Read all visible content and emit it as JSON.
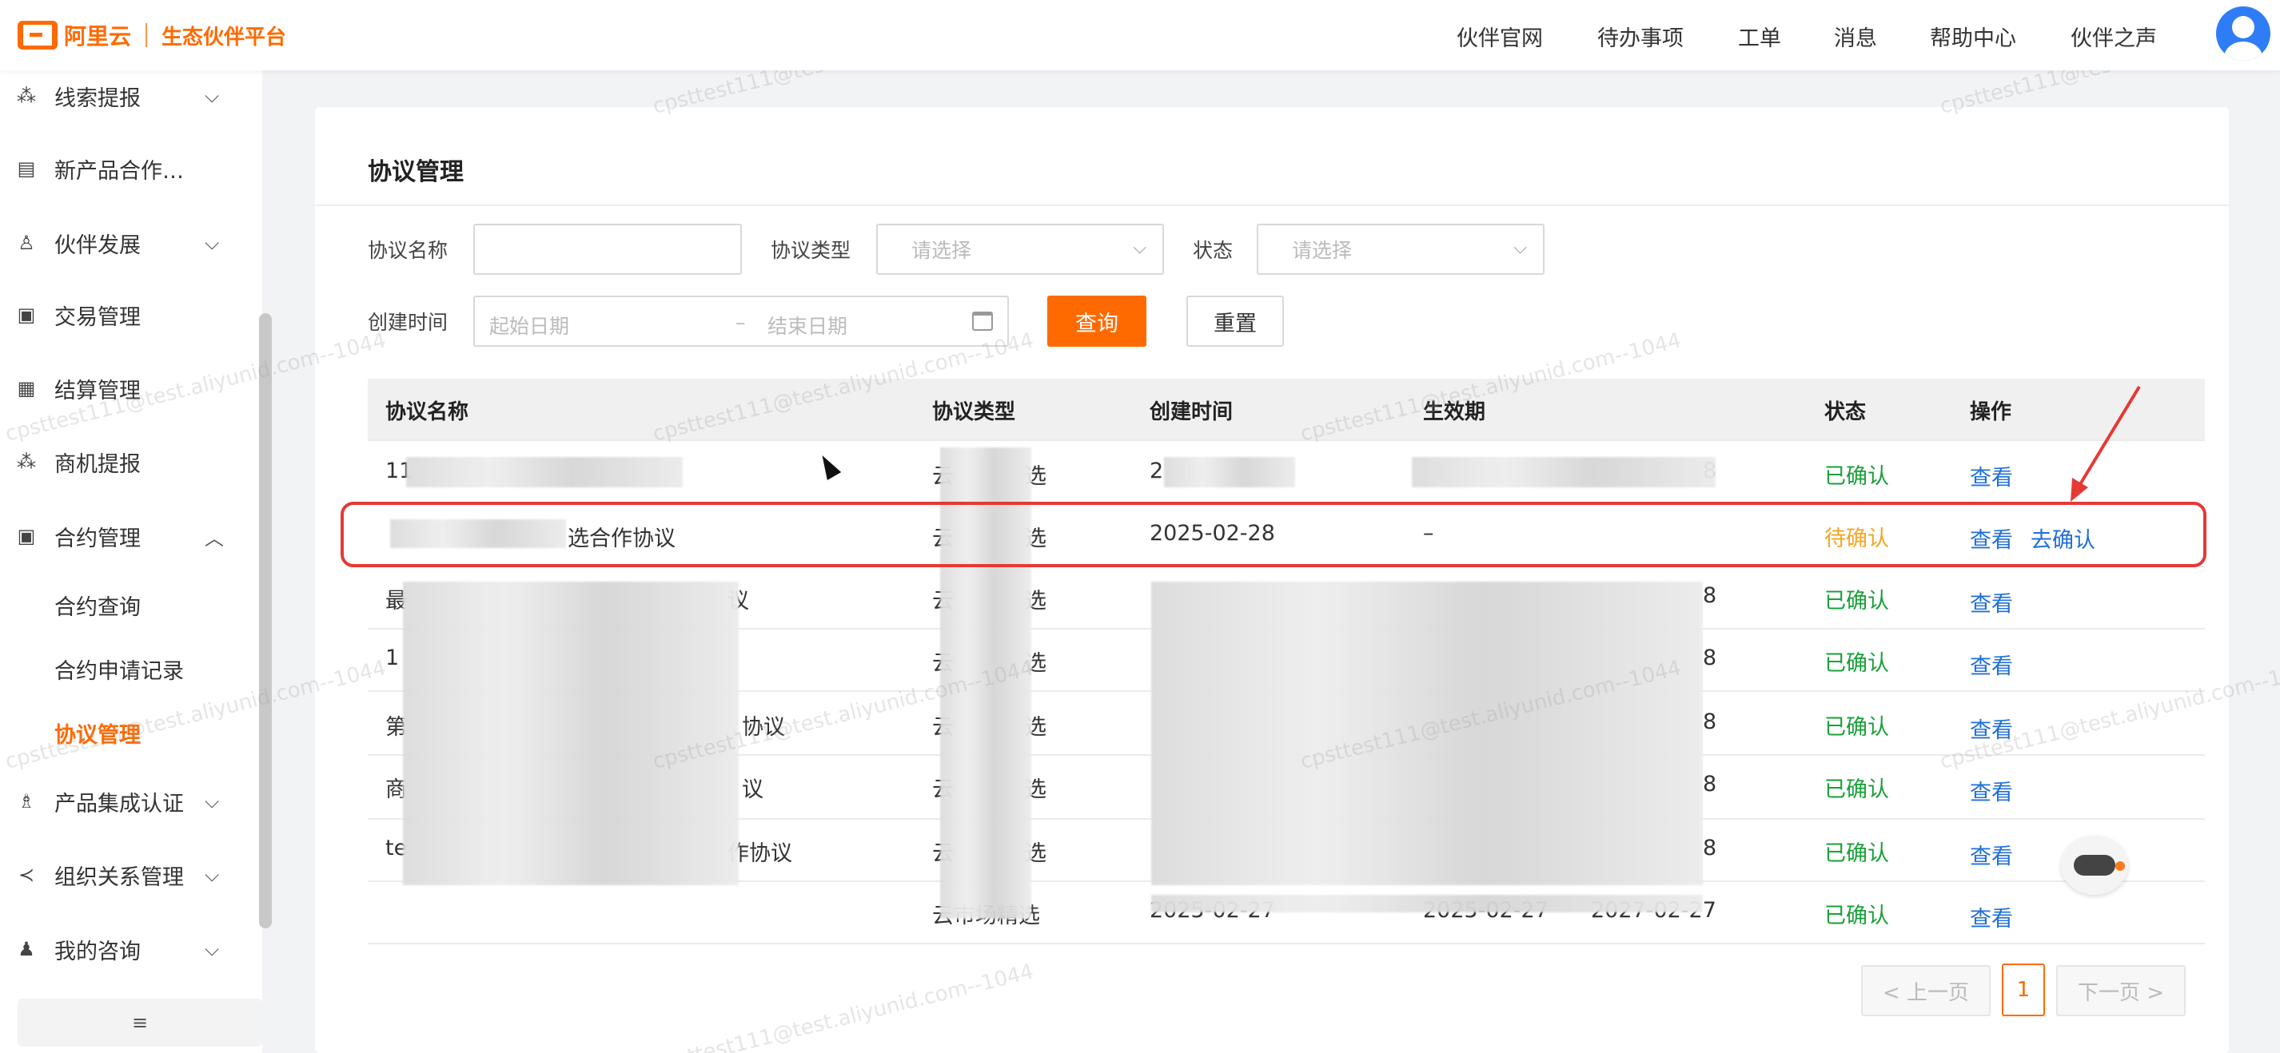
{
  "brand": {
    "logo_text": "阿里云",
    "subtitle": "生态伙伴平台"
  },
  "topnav": [
    "伙伴官网",
    "待办事项",
    "工单",
    "消息",
    "帮助中心",
    "伙伴之声"
  ],
  "sidebar": {
    "items": [
      {
        "label": "线索提报",
        "icon": "share-nodes-icon",
        "chevron": "⌵"
      },
      {
        "label": "新产品合作…",
        "icon": "document-icon"
      },
      {
        "label": "伙伴发展",
        "icon": "people-icon",
        "chevron": "⌵"
      },
      {
        "label": "交易管理",
        "icon": "calendar-icon"
      },
      {
        "label": "结算管理",
        "icon": "grid-icon"
      },
      {
        "label": "商机提报",
        "icon": "share-nodes-icon"
      },
      {
        "label": "合约管理",
        "icon": "calendar-icon",
        "chevron": "︿"
      },
      {
        "label": "产品集成认证",
        "icon": "user-check-icon",
        "chevron": "⌵"
      },
      {
        "label": "组织关系管理",
        "icon": "share-icon",
        "chevron": "⌵"
      },
      {
        "label": "我的咨询",
        "icon": "user-icon",
        "chevron": "⌵"
      }
    ],
    "subitems": [
      "合约查询",
      "合约申请记录",
      "协议管理"
    ],
    "collapse_icon": "≡"
  },
  "page": {
    "title": "协议管理"
  },
  "filters": {
    "name_label": "协议名称",
    "type_label": "协议类型",
    "type_placeholder": "请选择",
    "status_label": "状态",
    "status_placeholder": "请选择",
    "created_label": "创建时间",
    "start_placeholder": "起始日期",
    "range_sep": "–",
    "end_placeholder": "结束日期",
    "query_btn": "查询",
    "reset_btn": "重置"
  },
  "table": {
    "headers": [
      "协议名称",
      "协议类型",
      "创建时间",
      "生效期",
      "状态",
      "操作"
    ],
    "rows": [
      {
        "name": "11",
        "type": "云",
        "type_end": "选",
        "created": "2",
        "effective": "",
        "effective_end": "8",
        "status": "已确认",
        "actions": [
          "查看"
        ]
      },
      {
        "name": "",
        "name_end": "选合作协议",
        "type": "云",
        "type_end": "选",
        "created": "2025-02-28",
        "effective": "–",
        "effective_end": "",
        "status": "待确认",
        "actions": [
          "查看",
          "去确认"
        ]
      },
      {
        "name": "最",
        "name_end": "议",
        "type": "云",
        "type_end": "选",
        "created": "",
        "effective": "",
        "effective_end": "8",
        "status": "已确认",
        "actions": [
          "查看"
        ]
      },
      {
        "name": "1",
        "type": "云",
        "type_end": "选",
        "created": "",
        "effective": "",
        "effective_end": "8",
        "status": "已确认",
        "actions": [
          "查看"
        ]
      },
      {
        "name": "第",
        "name_end": "协议",
        "type": "云",
        "type_end": "选",
        "created": "",
        "effective": "",
        "effective_end": "8",
        "status": "已确认",
        "actions": [
          "查看"
        ]
      },
      {
        "name": "商",
        "name_end": "议",
        "type": "云",
        "type_end": "选",
        "created": "",
        "effective": "",
        "effective_end": "8",
        "status": "已确认",
        "actions": [
          "查看"
        ]
      },
      {
        "name": "te",
        "name_end": "作协议",
        "type": "云",
        "type_end": "选",
        "created": "",
        "effective": "",
        "effective_end": "8",
        "status": "已确认",
        "actions": [
          "查看"
        ]
      },
      {
        "name": "",
        "type": "云市场精选",
        "type_end": "",
        "created": "2025-02-27",
        "effective": "2025-02-27",
        "effective_end": "2027-02-27",
        "status": "已确认",
        "actions": [
          "查看"
        ]
      }
    ]
  },
  "pager": {
    "prev": "< 上一页",
    "current": "1",
    "next": "下一页 >"
  },
  "watermark": "cpsttest111@test.aliyunid.com--1044",
  "colors": {
    "accent": "#ff6a00",
    "link": "#1f6fd8",
    "ok": "#1a9f3a",
    "pending": "#f5a623",
    "annotation": "#e53935"
  }
}
